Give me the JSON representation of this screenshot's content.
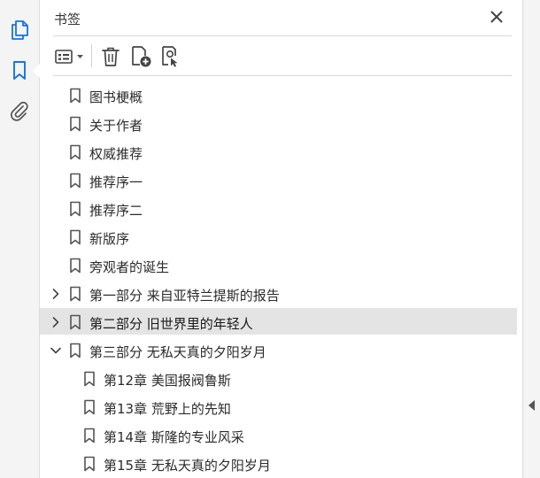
{
  "rail": {
    "items": [
      {
        "icon": "pages-icon",
        "active": false
      },
      {
        "icon": "bookmark-icon",
        "active": true
      },
      {
        "icon": "paperclip-icon",
        "active": false
      }
    ],
    "accent": "#1473e6"
  },
  "panel": {
    "title": "书签"
  },
  "bookmarks": [
    {
      "label": "图书梗概",
      "level": 0,
      "expander": "none",
      "selected": false
    },
    {
      "label": "关于作者",
      "level": 0,
      "expander": "none",
      "selected": false
    },
    {
      "label": "权威推荐",
      "level": 0,
      "expander": "none",
      "selected": false
    },
    {
      "label": "推荐序一",
      "level": 0,
      "expander": "none",
      "selected": false
    },
    {
      "label": "推荐序二",
      "level": 0,
      "expander": "none",
      "selected": false
    },
    {
      "label": "新版序",
      "level": 0,
      "expander": "none",
      "selected": false
    },
    {
      "label": "旁观者的诞生",
      "level": 0,
      "expander": "none",
      "selected": false
    },
    {
      "label": "第一部分 来自亚特兰提斯的报告",
      "level": 0,
      "expander": "collapsed",
      "selected": false
    },
    {
      "label": "第二部分 旧世界里的年轻人",
      "level": 0,
      "expander": "collapsed",
      "selected": true
    },
    {
      "label": "第三部分 无私天真的夕阳岁月",
      "level": 0,
      "expander": "expanded",
      "selected": false
    },
    {
      "label": "第12章 美国报阀鲁斯",
      "level": 1,
      "expander": "none",
      "selected": false
    },
    {
      "label": "第13章 荒野上的先知",
      "level": 1,
      "expander": "none",
      "selected": false
    },
    {
      "label": "第14章 斯隆的专业风采",
      "level": 1,
      "expander": "none",
      "selected": false
    },
    {
      "label": "第15章 无私天真的夕阳岁月",
      "level": 1,
      "expander": "none",
      "selected": false
    }
  ]
}
